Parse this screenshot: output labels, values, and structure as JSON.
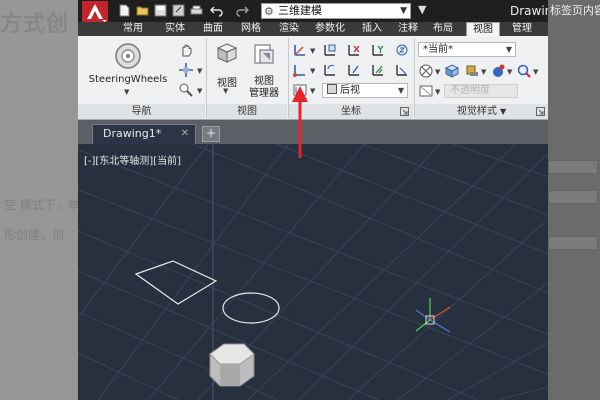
{
  "background": {
    "title": "方式创",
    "line1": "空 模式下，单",
    "line2": "形创建，创",
    "side_text": "标签页内容"
  },
  "titlebar": {
    "workspace": "三维建模",
    "app_title": "Drawing"
  },
  "tabs": [
    "常用",
    "实体",
    "曲面",
    "网格",
    "渲染",
    "参数化",
    "插入",
    "注释",
    "布局",
    "视图",
    "管理"
  ],
  "active_tab": "视图",
  "ribbon": {
    "steering_label": "SteeringWheels",
    "view_label": "视图",
    "view_manager_label_line1": "视图",
    "view_manager_label_line2": "管理器",
    "ucs_combo": "后视",
    "visual_style_combo": "*当前*",
    "disabled_field": "不透明度",
    "panels": {
      "navigation": "导航",
      "view": "视图",
      "coordinates": "坐标",
      "visual_styles": "视觉样式"
    }
  },
  "document": {
    "tab_label": "Drawing1*",
    "viewport_label": "[-][东北等轴测][当前]"
  },
  "colors": {
    "annotation_arrow": "#e8242a",
    "grid_line": "#3c4658",
    "shape_stroke": "#e8e8e8"
  }
}
